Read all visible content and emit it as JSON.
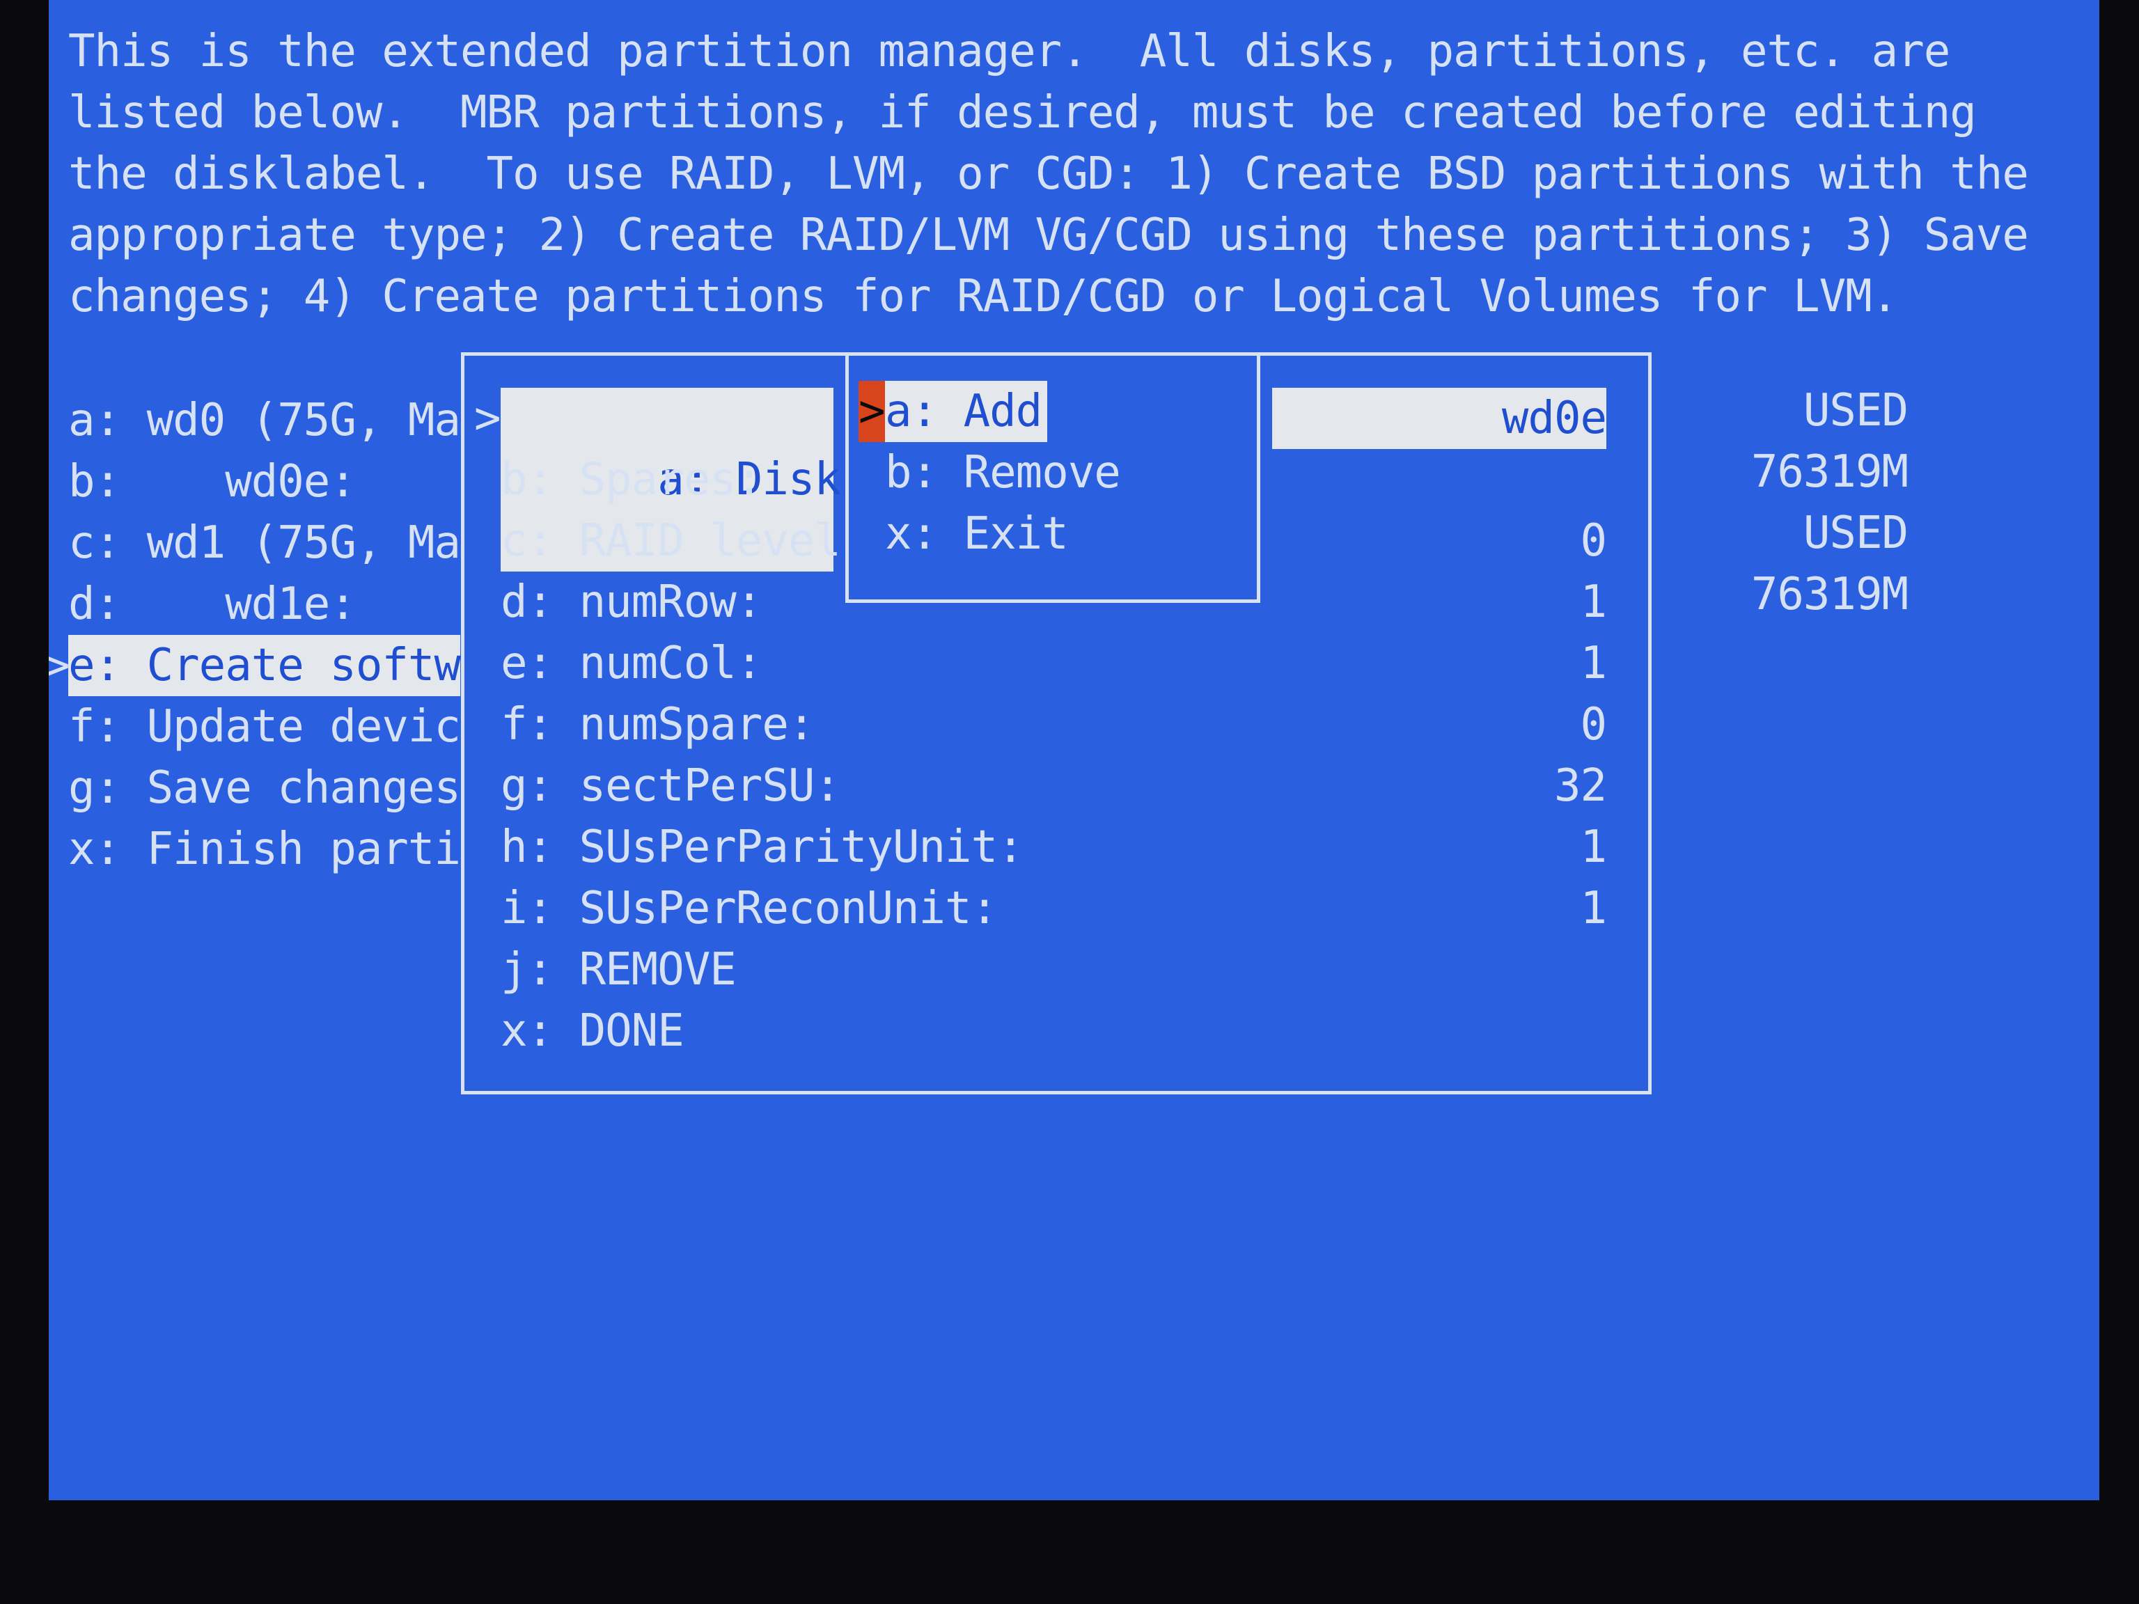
{
  "intro": [
    "This is the extended partition manager.  All disks, partitions, etc. are",
    "listed below.  MBR partitions, if desired, must be created before editing",
    "the disklabel.  To use RAID, LVM, or CGD: 1) Create BSD partitions with the",
    "appropriate type; 2) Create RAID/LVM VG/CGD using these partitions; 3) Save",
    "changes; 4) Create partitions for RAID/CGD or Logical Volumes for LVM."
  ],
  "main_menu": {
    "cursor": ">",
    "items": [
      {
        "label": "a: wd0 (75G, Ma",
        "status": "USED"
      },
      {
        "label": "b:    wd0e:",
        "status": "76319M"
      },
      {
        "label": "c: wd1 (75G, Ma",
        "status": "USED"
      },
      {
        "label": "d:    wd1e:",
        "status": "76319M"
      },
      {
        "label": "e: Create softw",
        "status": ""
      },
      {
        "label": "f: Update devic",
        "status": ""
      },
      {
        "label": "g: Save changes",
        "status": ""
      },
      {
        "label": "x: Finish parti",
        "status": ""
      }
    ]
  },
  "raid_menu": {
    "cursor": ">",
    "items": [
      {
        "label": "a: Disks:",
        "value": "wd0e"
      },
      {
        "label": "b: Spares:",
        "value": ""
      },
      {
        "label": "c: RAID level",
        "value": "0"
      },
      {
        "label": "d: numRow:",
        "value": "1"
      },
      {
        "label": "e: numCol:",
        "value": "1"
      },
      {
        "label": "f: numSpare:",
        "value": "0"
      },
      {
        "label": "g: sectPerSU:",
        "value": "32"
      },
      {
        "label": "h: SUsPerParityUnit:",
        "value": "1"
      },
      {
        "label": "i: SUsPerReconUnit:",
        "value": "1"
      },
      {
        "label": "j: REMOVE",
        "value": ""
      },
      {
        "label": "x: DONE",
        "value": ""
      }
    ]
  },
  "disk_submenu": {
    "cursor": ">",
    "cursor_color": "#d8451c",
    "items": [
      {
        "label": "a: Add"
      },
      {
        "label": "b: Remove"
      },
      {
        "label": "x: Exit"
      }
    ]
  },
  "colors": {
    "background": "#2a5fe0",
    "text": "#d6e2f4",
    "highlight_bg": "#e4e8ec",
    "highlight_text": "#1f4fd0"
  }
}
